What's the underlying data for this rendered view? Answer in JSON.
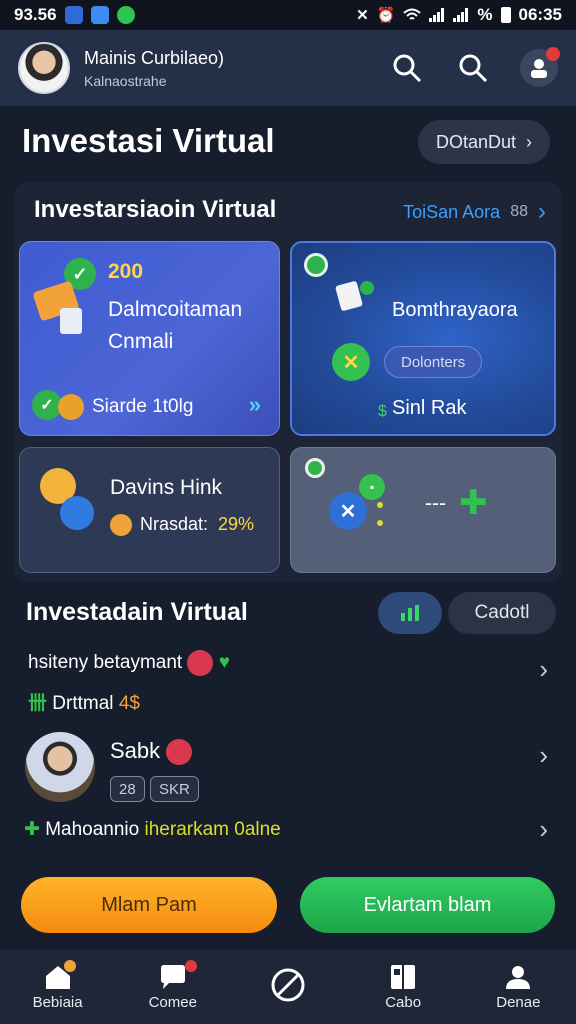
{
  "status": {
    "time_left": "93.56",
    "battery": "%",
    "time_right": "06:35"
  },
  "header": {
    "name": "Mainis Curbilaeo)",
    "subtitle": "Kalnaostrahe"
  },
  "page": {
    "title": "Investasi Virtual",
    "pill_label": "DOtanDut"
  },
  "section": {
    "title": "Investarsiaoin Virtual",
    "link_label": "ToiSan Aora",
    "link_count": "88"
  },
  "tiles": {
    "t1_number": "200",
    "t1_title_line1": "Dalmcoitaman",
    "t1_title_line2": "Cnmali",
    "t1_footer": "Siarde 1t0lg",
    "t2_title": "Bomthrayaora",
    "t2_chip": "Dolonters",
    "t2_footer": "Sinl Rak",
    "t3_title": "Davins Hink",
    "t3_label": "Nrasdat:",
    "t3_value": "29%",
    "t4_dash": "---"
  },
  "section2": {
    "title": "Investadain Virtual",
    "toggle_label": "Cadotl"
  },
  "list": {
    "row1_title": "hsiteny betaymant",
    "row1_sub_label": "Drttmal",
    "row1_sub_value": "4$",
    "row2_title": "Sabk",
    "row2_tag1": "28",
    "row2_tag2": "SKR",
    "row3_text_a": "Mahoannio",
    "row3_text_b": "iherarkam 0alne"
  },
  "actions": {
    "left_label": "Mlam Pam",
    "right_label": "Evlartam blam"
  },
  "nav": [
    {
      "label": "Bebiaia"
    },
    {
      "label": "Comee"
    },
    {
      "label": ""
    },
    {
      "label": "Cabo"
    },
    {
      "label": "Denae"
    }
  ],
  "colors": {
    "accent_blue": "#3aa0ff",
    "orange": "#f58a0f",
    "green": "#1fa44a",
    "yellow": "#ffd54a"
  }
}
